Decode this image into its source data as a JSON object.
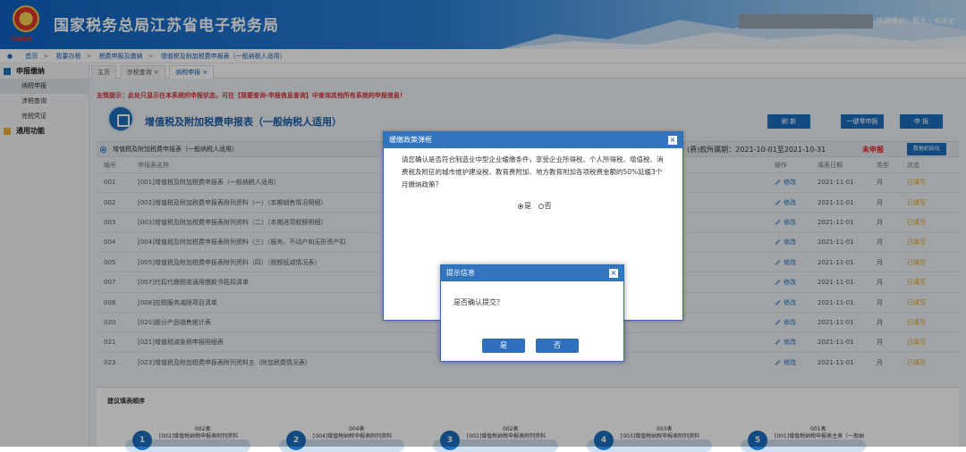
{
  "header": {
    "emblem_text": "中国税务",
    "title": "国家税务总局江苏省电子税务局",
    "links": "信用级别：暂无 | 关闭全"
  },
  "breadcrumb": [
    "首页",
    "我要办税",
    "税费申报及缴纳",
    "增值税及附加税费申报表（一般纳税人适用）"
  ],
  "sidebar": {
    "group1": "申报缴纳",
    "items": [
      "纳税申报",
      "涉税查询",
      "完税凭证"
    ],
    "group2": "通用功能"
  },
  "tabs": [
    "主页",
    "涉税查询 ×",
    "纳税申报 ×"
  ],
  "page": {
    "tip": "友情提示：此处只显示在本系统的申报状态，可在【我要查询-申报信息查询】中查询其他所有系统的申报信息！",
    "form_title": "增值税及附加税费申报表（一般纳税人适用）",
    "btn_refresh": "刷 新",
    "btn_zero": "一键零申报",
    "btn_submit": "申 报",
    "sub_title": "增值税及附加税费申报表（一般纳税人适用）",
    "period": "(费)款所属期：2021-10-01至2021-10-31",
    "status": "未申报",
    "init_btn": "数据初始化"
  },
  "table": {
    "headers": [
      "编号",
      "申报表名称",
      "操作",
      "填表日期",
      "类型",
      "状态"
    ],
    "rows": [
      {
        "no": "001",
        "name": "[001]增值税及附加税费申报表（一般纳税人适用）",
        "op": "修改",
        "date": "2021-11-01",
        "type": "月",
        "state": "已填写"
      },
      {
        "no": "002",
        "name": "[002]增值税及附加税费申报表附列资料（一）（本期销售情况明细）",
        "op": "修改",
        "date": "2021-11-01",
        "type": "月",
        "state": "已填写"
      },
      {
        "no": "003",
        "name": "[003]增值税及附加税费申报表附列资料（二）（本期进项税额明细）",
        "op": "修改",
        "date": "2021-11-01",
        "type": "月",
        "state": "已填写"
      },
      {
        "no": "004",
        "name": "[004]增值税及附加税费申报表附列资料（三）（服务、不动产和无形资产扣",
        "op": "修改",
        "date": "2021-11-01",
        "type": "月",
        "state": "已填写"
      },
      {
        "no": "005",
        "name": "[005]增值税及附加税费申报表附列资料（四）（税额抵减情况表）",
        "op": "修改",
        "date": "2021-11-01",
        "type": "月",
        "state": "已填写"
      },
      {
        "no": "007",
        "name": "[007]代扣代缴税收通用缴款书抵扣清单",
        "op": "修改",
        "date": "2021-11-01",
        "type": "月",
        "state": "已填写"
      },
      {
        "no": "008",
        "name": "[008]应税服务减除项目清单",
        "op": "修改",
        "date": "2021-11-01",
        "type": "月",
        "state": "已填写"
      },
      {
        "no": "020",
        "name": "[020]部分产品销售统计表",
        "op": "修改",
        "date": "2021-11-01",
        "type": "月",
        "state": "已填写"
      },
      {
        "no": "021",
        "name": "[021]增值税减免税申报明细表",
        "op": "修改",
        "date": "2021-11-01",
        "type": "月",
        "state": "已填写"
      },
      {
        "no": "023",
        "name": "[023]增值税及附加税费申报表附列资料五（附加税费情况表）",
        "op": "修改",
        "date": "2021-11-01",
        "type": "月",
        "state": "已填写"
      }
    ]
  },
  "suggest": {
    "title": "建议填表顺序",
    "steps": [
      {
        "num": "1",
        "code": "002表",
        "desc": "[002]增值税纳税申报表附列资料"
      },
      {
        "num": "2",
        "code": "004表",
        "desc": "[004]增值税纳税申报表附列资料"
      },
      {
        "num": "3",
        "code": "002表",
        "desc": "[002]增值税纳税申报表附列资料"
      },
      {
        "num": "4",
        "code": "003表",
        "desc": "[003]增值税纳税申报表附列资料"
      },
      {
        "num": "5",
        "code": "001表",
        "desc": "[001]增值税纳税申报表主表（一般纳"
      }
    ]
  },
  "dialog_policy": {
    "title": "缓缴政策弹框",
    "text": "请您确认是否符合制造业中型企业缓缴条件，享受企业所得税、个人所得税、增值税、消费税及附征的城市维护建设税、教育费附加、地方教育附加各项税费金额的50%延缓3个月缴纳政策？",
    "yes": "是",
    "no": "否"
  },
  "dialog_confirm": {
    "title": "提示信息",
    "message": "是否确认提交？",
    "yes": "是",
    "no": "否"
  }
}
